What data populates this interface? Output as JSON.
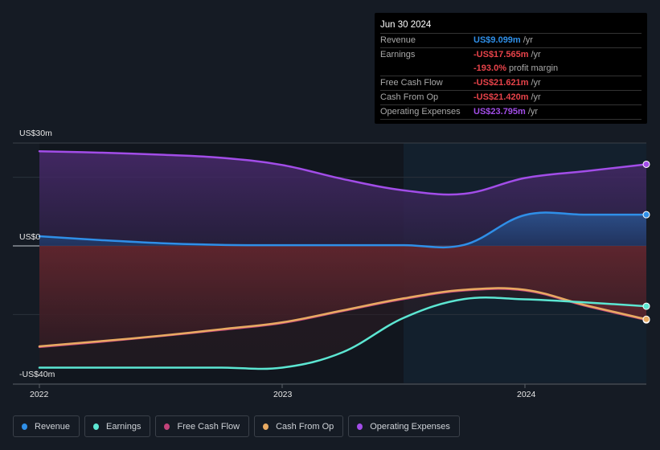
{
  "tooltip": {
    "date": "Jun 30 2024",
    "rows": [
      {
        "label": "Revenue",
        "value": "US$9.099m",
        "unit": "/yr",
        "color": "#2f8fe8"
      },
      {
        "label": "Earnings",
        "value": "-US$17.565m",
        "unit": "/yr",
        "color": "#e8434a"
      },
      {
        "label": "",
        "value": "-193.0%",
        "unit": "profit margin",
        "color": "#e8434a"
      },
      {
        "label": "Free Cash Flow",
        "value": "-US$21.621m",
        "unit": "/yr",
        "color": "#e8434a"
      },
      {
        "label": "Cash From Op",
        "value": "-US$21.420m",
        "unit": "/yr",
        "color": "#e8434a"
      },
      {
        "label": "Operating Expenses",
        "value": "US$23.795m",
        "unit": "/yr",
        "color": "#a24de8"
      }
    ]
  },
  "legend": [
    {
      "label": "Revenue",
      "color": "#2f8fe8"
    },
    {
      "label": "Earnings",
      "color": "#5ce6d2"
    },
    {
      "label": "Free Cash Flow",
      "color": "#c2437a"
    },
    {
      "label": "Cash From Op",
      "color": "#e8aa62"
    },
    {
      "label": "Operating Expenses",
      "color": "#a24de8"
    }
  ],
  "chart_data": {
    "type": "line",
    "title": "",
    "xlabel": "",
    "ylabel": "",
    "y_tick_labels": [
      "US$30m",
      "US$0",
      "-US$40m"
    ],
    "x_tick_labels": [
      "2022",
      "2023",
      "2024"
    ],
    "ylim": [
      -40,
      30
    ],
    "xlim": [
      2022.0,
      2024.5
    ],
    "highlight_start": 2023.5,
    "grid": true,
    "x": [
      2022.0,
      2022.25,
      2022.5,
      2022.75,
      2023.0,
      2023.25,
      2023.5,
      2023.75,
      2024.0,
      2024.25,
      2024.5
    ],
    "series": [
      {
        "name": "Revenue",
        "color": "#2f8fe8",
        "values": [
          2.8,
          1.7,
          0.8,
          0.3,
          0.2,
          0.2,
          0.2,
          0.3,
          9.0,
          9.1,
          9.1
        ]
      },
      {
        "name": "Earnings",
        "color": "#5ce6d2",
        "values": [
          -35.5,
          -35.5,
          -35.5,
          -35.5,
          -35.5,
          -31.0,
          -21.0,
          -15.5,
          -15.6,
          -16.5,
          -17.6
        ]
      },
      {
        "name": "Free Cash Flow",
        "color": "#c2437a",
        "values": [
          -29.5,
          -28.0,
          -26.3,
          -24.5,
          -22.5,
          -19.0,
          -15.5,
          -13.0,
          -13.0,
          -17.5,
          -21.6
        ]
      },
      {
        "name": "Cash From Op",
        "color": "#e8aa62",
        "values": [
          -29.3,
          -27.8,
          -26.2,
          -24.3,
          -22.3,
          -18.8,
          -15.3,
          -12.8,
          -12.8,
          -17.3,
          -21.4
        ]
      },
      {
        "name": "Operating Expenses",
        "color": "#a24de8",
        "values": [
          27.6,
          27.2,
          26.6,
          25.7,
          23.6,
          19.5,
          16.2,
          15.2,
          19.8,
          21.8,
          23.8
        ]
      }
    ]
  }
}
